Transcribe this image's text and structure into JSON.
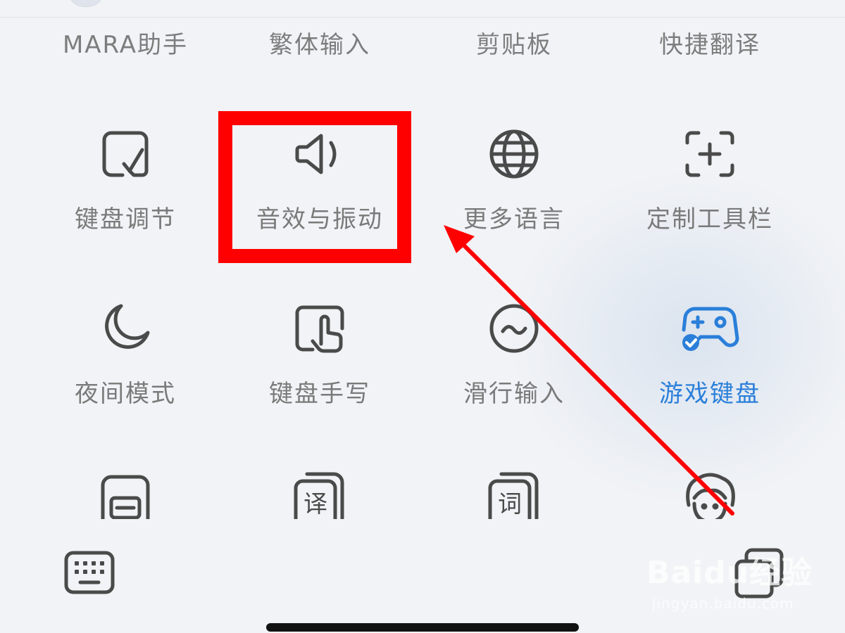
{
  "top_row": {
    "labels": [
      "MARA助手",
      "繁体输入",
      "剪贴板",
      "快捷翻译"
    ]
  },
  "grid": {
    "items": [
      {
        "label": "键盘调节",
        "icon": "keyboard-adjust-icon",
        "accent": false
      },
      {
        "label": "音效与振动",
        "icon": "speaker-icon",
        "accent": false,
        "highlighted": true
      },
      {
        "label": "更多语言",
        "icon": "globe-icon",
        "accent": false
      },
      {
        "label": "定制工具栏",
        "icon": "customize-toolbar-icon",
        "accent": false
      },
      {
        "label": "夜间模式",
        "icon": "moon-icon",
        "accent": false
      },
      {
        "label": "键盘手写",
        "icon": "handwriting-icon",
        "accent": false
      },
      {
        "label": "滑行输入",
        "icon": "swipe-input-icon",
        "accent": false
      },
      {
        "label": "游戏键盘",
        "icon": "gamepad-icon",
        "accent": true
      }
    ],
    "partial_icons": [
      "keyboard-frame-icon",
      "translate-card-icon",
      "word-card-icon",
      "avatar-face-icon"
    ]
  },
  "watermark": {
    "brand": "Baidu经验",
    "domain": "jingyan.baidu.com"
  },
  "colors": {
    "background": "#f1f3f6",
    "label": "#7a7a7a",
    "icon_stroke": "#4a4a4a",
    "accent": "#2a7fd9",
    "annotation": "#ff0000"
  }
}
